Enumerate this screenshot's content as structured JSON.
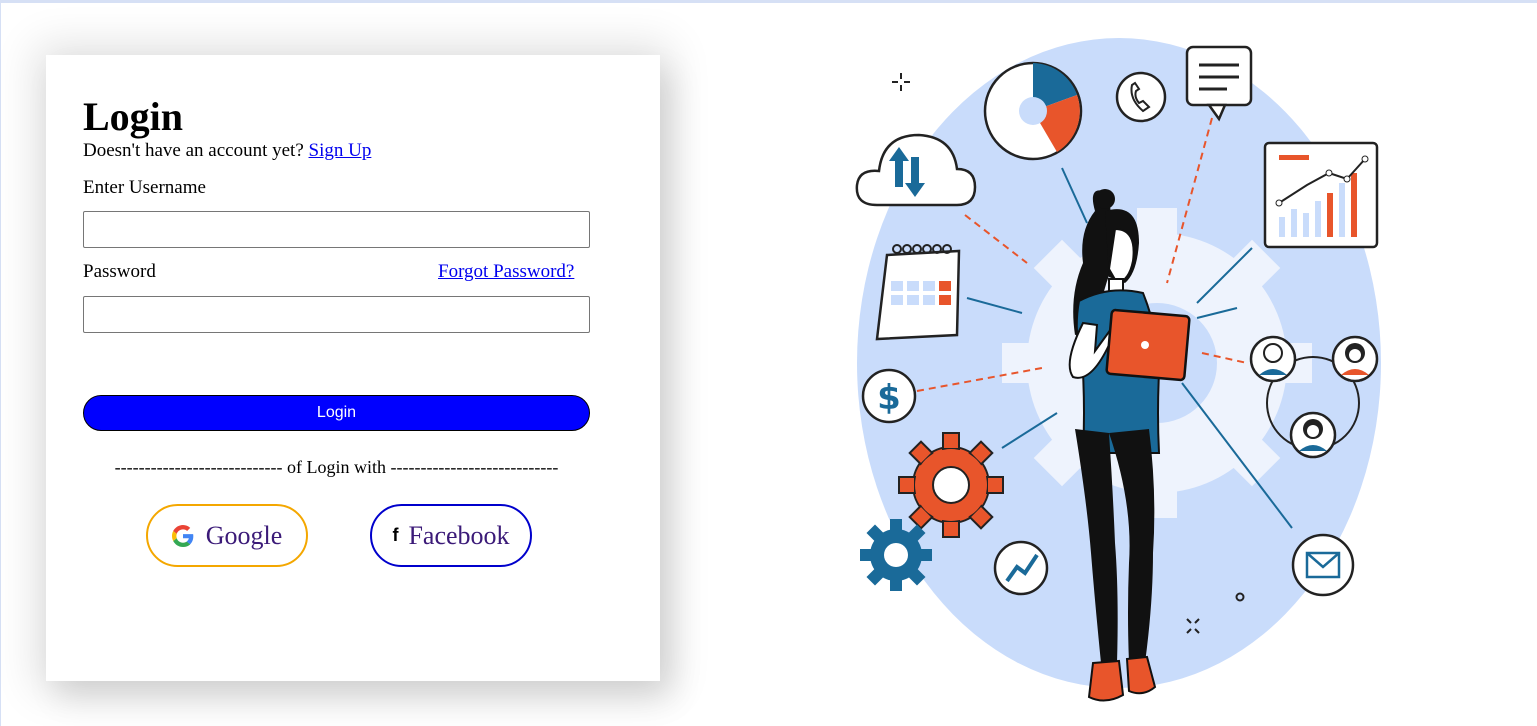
{
  "login_form": {
    "title": "Login",
    "signup_prompt": "Doesn't have an account yet?",
    "signup_link": "Sign Up",
    "username_label": "Enter Username",
    "username_value": "",
    "password_label": "Password",
    "password_value": "",
    "forgot_link": "Forgot Password?",
    "login_button": "Login",
    "divider_text": "---------------------------- of Login with ----------------------------"
  },
  "social": {
    "google_label": "Google",
    "facebook_label": "Facebook",
    "facebook_icon_glyph": "f"
  },
  "colors": {
    "login_button_bg": "#0000ff",
    "google_border": "#f4a700",
    "facebook_border": "#0000cc",
    "link": "#0000ee",
    "illustration_bg": "#c9dcfb",
    "accent_orange": "#e8552b",
    "accent_blue": "#1a6a99"
  },
  "illustration": {
    "icons": [
      "cloud-sync-icon",
      "pie-chart-icon",
      "phone-icon",
      "message-icon",
      "bar-chart-icon",
      "calendar-icon",
      "dollar-icon",
      "team-icon",
      "gear-icon",
      "trend-icon",
      "mail-icon"
    ]
  }
}
